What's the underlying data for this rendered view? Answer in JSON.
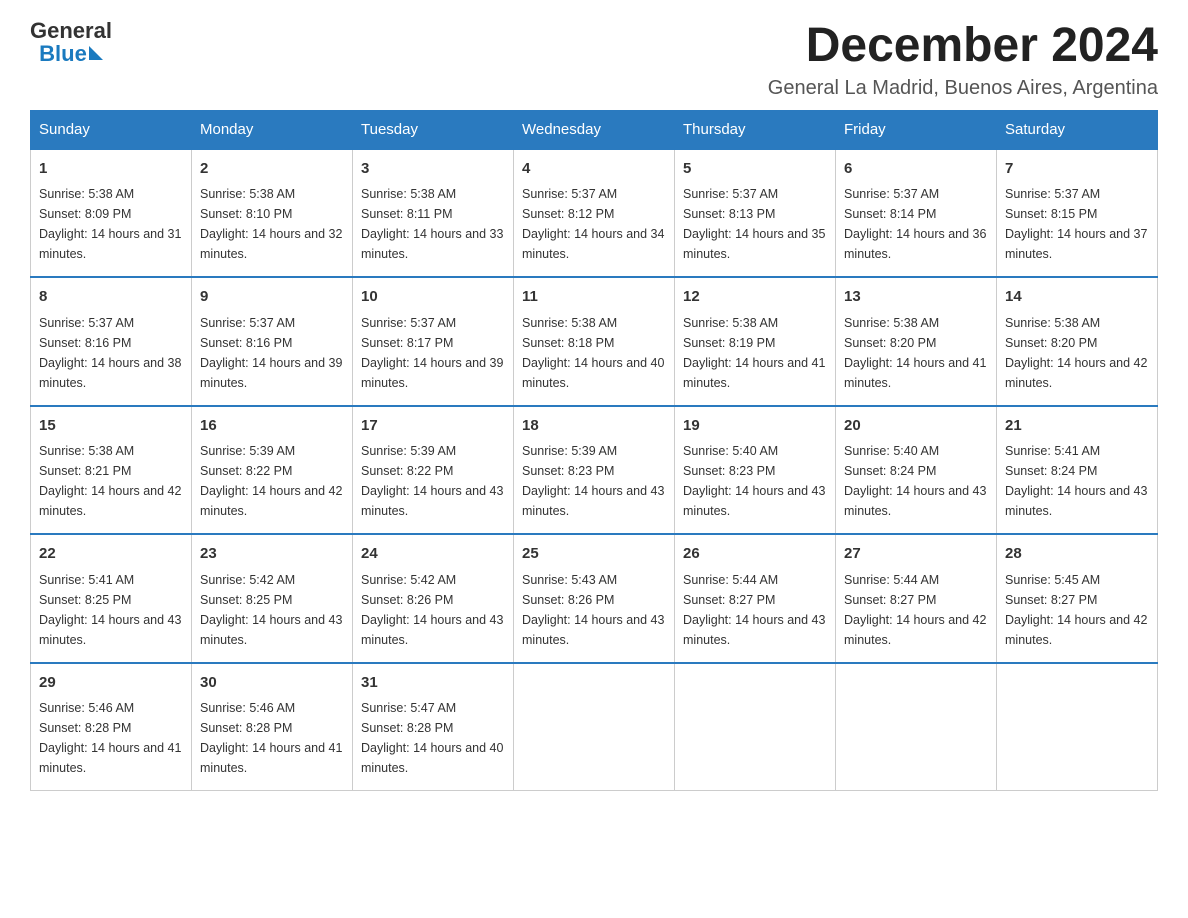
{
  "logo": {
    "general": "General",
    "blue": "Blue"
  },
  "header": {
    "month_year": "December 2024",
    "location": "General La Madrid, Buenos Aires, Argentina"
  },
  "weekdays": [
    "Sunday",
    "Monday",
    "Tuesday",
    "Wednesday",
    "Thursday",
    "Friday",
    "Saturday"
  ],
  "weeks": [
    [
      {
        "day": "1",
        "sunrise": "5:38 AM",
        "sunset": "8:09 PM",
        "daylight": "14 hours and 31 minutes."
      },
      {
        "day": "2",
        "sunrise": "5:38 AM",
        "sunset": "8:10 PM",
        "daylight": "14 hours and 32 minutes."
      },
      {
        "day": "3",
        "sunrise": "5:38 AM",
        "sunset": "8:11 PM",
        "daylight": "14 hours and 33 minutes."
      },
      {
        "day": "4",
        "sunrise": "5:37 AM",
        "sunset": "8:12 PM",
        "daylight": "14 hours and 34 minutes."
      },
      {
        "day": "5",
        "sunrise": "5:37 AM",
        "sunset": "8:13 PM",
        "daylight": "14 hours and 35 minutes."
      },
      {
        "day": "6",
        "sunrise": "5:37 AM",
        "sunset": "8:14 PM",
        "daylight": "14 hours and 36 minutes."
      },
      {
        "day": "7",
        "sunrise": "5:37 AM",
        "sunset": "8:15 PM",
        "daylight": "14 hours and 37 minutes."
      }
    ],
    [
      {
        "day": "8",
        "sunrise": "5:37 AM",
        "sunset": "8:16 PM",
        "daylight": "14 hours and 38 minutes."
      },
      {
        "day": "9",
        "sunrise": "5:37 AM",
        "sunset": "8:16 PM",
        "daylight": "14 hours and 39 minutes."
      },
      {
        "day": "10",
        "sunrise": "5:37 AM",
        "sunset": "8:17 PM",
        "daylight": "14 hours and 39 minutes."
      },
      {
        "day": "11",
        "sunrise": "5:38 AM",
        "sunset": "8:18 PM",
        "daylight": "14 hours and 40 minutes."
      },
      {
        "day": "12",
        "sunrise": "5:38 AM",
        "sunset": "8:19 PM",
        "daylight": "14 hours and 41 minutes."
      },
      {
        "day": "13",
        "sunrise": "5:38 AM",
        "sunset": "8:20 PM",
        "daylight": "14 hours and 41 minutes."
      },
      {
        "day": "14",
        "sunrise": "5:38 AM",
        "sunset": "8:20 PM",
        "daylight": "14 hours and 42 minutes."
      }
    ],
    [
      {
        "day": "15",
        "sunrise": "5:38 AM",
        "sunset": "8:21 PM",
        "daylight": "14 hours and 42 minutes."
      },
      {
        "day": "16",
        "sunrise": "5:39 AM",
        "sunset": "8:22 PM",
        "daylight": "14 hours and 42 minutes."
      },
      {
        "day": "17",
        "sunrise": "5:39 AM",
        "sunset": "8:22 PM",
        "daylight": "14 hours and 43 minutes."
      },
      {
        "day": "18",
        "sunrise": "5:39 AM",
        "sunset": "8:23 PM",
        "daylight": "14 hours and 43 minutes."
      },
      {
        "day": "19",
        "sunrise": "5:40 AM",
        "sunset": "8:23 PM",
        "daylight": "14 hours and 43 minutes."
      },
      {
        "day": "20",
        "sunrise": "5:40 AM",
        "sunset": "8:24 PM",
        "daylight": "14 hours and 43 minutes."
      },
      {
        "day": "21",
        "sunrise": "5:41 AM",
        "sunset": "8:24 PM",
        "daylight": "14 hours and 43 minutes."
      }
    ],
    [
      {
        "day": "22",
        "sunrise": "5:41 AM",
        "sunset": "8:25 PM",
        "daylight": "14 hours and 43 minutes."
      },
      {
        "day": "23",
        "sunrise": "5:42 AM",
        "sunset": "8:25 PM",
        "daylight": "14 hours and 43 minutes."
      },
      {
        "day": "24",
        "sunrise": "5:42 AM",
        "sunset": "8:26 PM",
        "daylight": "14 hours and 43 minutes."
      },
      {
        "day": "25",
        "sunrise": "5:43 AM",
        "sunset": "8:26 PM",
        "daylight": "14 hours and 43 minutes."
      },
      {
        "day": "26",
        "sunrise": "5:44 AM",
        "sunset": "8:27 PM",
        "daylight": "14 hours and 43 minutes."
      },
      {
        "day": "27",
        "sunrise": "5:44 AM",
        "sunset": "8:27 PM",
        "daylight": "14 hours and 42 minutes."
      },
      {
        "day": "28",
        "sunrise": "5:45 AM",
        "sunset": "8:27 PM",
        "daylight": "14 hours and 42 minutes."
      }
    ],
    [
      {
        "day": "29",
        "sunrise": "5:46 AM",
        "sunset": "8:28 PM",
        "daylight": "14 hours and 41 minutes."
      },
      {
        "day": "30",
        "sunrise": "5:46 AM",
        "sunset": "8:28 PM",
        "daylight": "14 hours and 41 minutes."
      },
      {
        "day": "31",
        "sunrise": "5:47 AM",
        "sunset": "8:28 PM",
        "daylight": "14 hours and 40 minutes."
      },
      null,
      null,
      null,
      null
    ]
  ]
}
